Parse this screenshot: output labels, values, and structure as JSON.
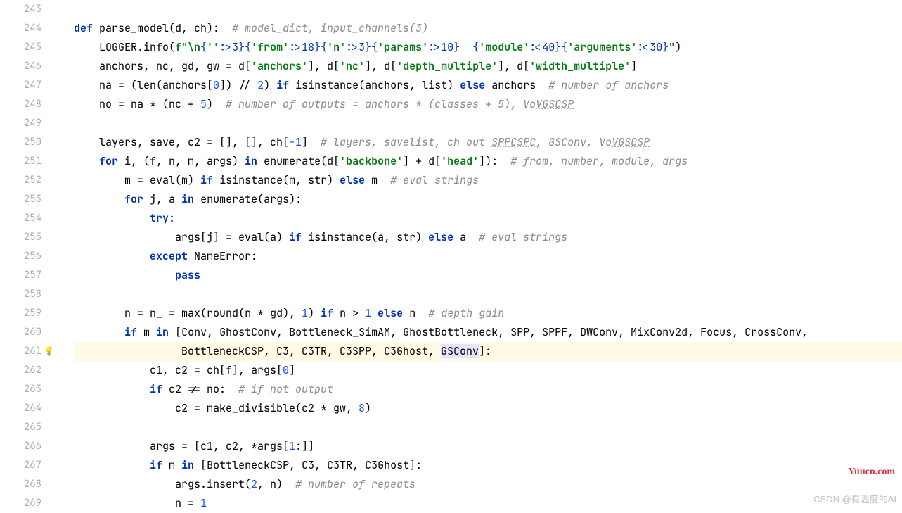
{
  "watermark_br": "CSDN @有温度的AI",
  "watermark_tr": "Yuucn.com",
  "lineStart": 243,
  "bulbLine": 261,
  "lines": [
    {
      "n": 243,
      "tokens": []
    },
    {
      "n": 244,
      "tokens": [
        {
          "t": "def ",
          "c": "kw"
        },
        {
          "t": "parse_model(d, ch):  ",
          "c": "fn"
        },
        {
          "t": "# model_dict, input_channels(3)",
          "c": "cmt"
        }
      ]
    },
    {
      "n": 245,
      "tokens": [
        {
          "t": "    LOGGER.info(",
          "c": "name"
        },
        {
          "t": "f\"\\n",
          "c": "str"
        },
        {
          "t": "{",
          "c": "fstr"
        },
        {
          "t": "''",
          "c": "str"
        },
        {
          "t": ":>3}{",
          "c": "fstr"
        },
        {
          "t": "'from'",
          "c": "str"
        },
        {
          "t": ":>18}{",
          "c": "fstr"
        },
        {
          "t": "'n'",
          "c": "str"
        },
        {
          "t": ":>3}{",
          "c": "fstr"
        },
        {
          "t": "'params'",
          "c": "str"
        },
        {
          "t": ":>10}",
          "c": "fstr"
        },
        {
          "t": "  ",
          "c": "str"
        },
        {
          "t": "{",
          "c": "fstr"
        },
        {
          "t": "'module'",
          "c": "str"
        },
        {
          "t": ":<40}{",
          "c": "fstr"
        },
        {
          "t": "'arguments'",
          "c": "str"
        },
        {
          "t": ":<30}",
          "c": "fstr"
        },
        {
          "t": "\"",
          "c": "str"
        },
        {
          "t": ")",
          "c": "name"
        }
      ]
    },
    {
      "n": 246,
      "tokens": [
        {
          "t": "    anchors, nc, gd, gw = d[",
          "c": "name"
        },
        {
          "t": "'anchors'",
          "c": "str"
        },
        {
          "t": "], d[",
          "c": "name"
        },
        {
          "t": "'nc'",
          "c": "str"
        },
        {
          "t": "], d[",
          "c": "name"
        },
        {
          "t": "'depth_multiple'",
          "c": "str"
        },
        {
          "t": "], d[",
          "c": "name"
        },
        {
          "t": "'width_multiple'",
          "c": "str"
        },
        {
          "t": "]",
          "c": "name"
        }
      ]
    },
    {
      "n": 247,
      "tokens": [
        {
          "t": "    na = (",
          "c": "name"
        },
        {
          "t": "len",
          "c": "builtin"
        },
        {
          "t": "(anchors[",
          "c": "name"
        },
        {
          "t": "0",
          "c": "num"
        },
        {
          "t": "]) // ",
          "c": "name"
        },
        {
          "t": "2",
          "c": "num"
        },
        {
          "t": ") ",
          "c": "name"
        },
        {
          "t": "if ",
          "c": "kw"
        },
        {
          "t": "isinstance",
          "c": "builtin"
        },
        {
          "t": "(anchors, ",
          "c": "name"
        },
        {
          "t": "list",
          "c": "builtin"
        },
        {
          "t": ") ",
          "c": "name"
        },
        {
          "t": "else ",
          "c": "kw"
        },
        {
          "t": "anchors  ",
          "c": "name"
        },
        {
          "t": "# number of anchors",
          "c": "cmt"
        }
      ]
    },
    {
      "n": 248,
      "tokens": [
        {
          "t": "    no = na * (nc + ",
          "c": "name"
        },
        {
          "t": "5",
          "c": "num"
        },
        {
          "t": ")  ",
          "c": "name"
        },
        {
          "t": "# number of outputs = anchors * (classes + 5), Vo",
          "c": "cmt"
        },
        {
          "t": "VGSCSP",
          "c": "cmt cmt-underline"
        }
      ]
    },
    {
      "n": 249,
      "tokens": []
    },
    {
      "n": 250,
      "tokens": [
        {
          "t": "    layers, save, c2 = [], [], ch[",
          "c": "name"
        },
        {
          "t": "-1",
          "c": "num"
        },
        {
          "t": "]  ",
          "c": "name"
        },
        {
          "t": "# layers, savelist, ch out ",
          "c": "cmt"
        },
        {
          "t": "SPPCSPC",
          "c": "cmt cmt-underline"
        },
        {
          "t": ", GSConv, Vo",
          "c": "cmt"
        },
        {
          "t": "VGSCSP",
          "c": "cmt cmt-underline"
        }
      ]
    },
    {
      "n": 251,
      "tokens": [
        {
          "t": "    ",
          "c": "name"
        },
        {
          "t": "for ",
          "c": "kw"
        },
        {
          "t": "i, (f, n, m, args) ",
          "c": "name"
        },
        {
          "t": "in ",
          "c": "kw"
        },
        {
          "t": "enumerate",
          "c": "builtin"
        },
        {
          "t": "(d[",
          "c": "name"
        },
        {
          "t": "'backbone'",
          "c": "str"
        },
        {
          "t": "] + d[",
          "c": "name"
        },
        {
          "t": "'head'",
          "c": "str"
        },
        {
          "t": "]):  ",
          "c": "name"
        },
        {
          "t": "# from, number, module, args",
          "c": "cmt"
        }
      ]
    },
    {
      "n": 252,
      "tokens": [
        {
          "t": "        m = ",
          "c": "name"
        },
        {
          "t": "eval",
          "c": "builtin"
        },
        {
          "t": "(m) ",
          "c": "name"
        },
        {
          "t": "if ",
          "c": "kw"
        },
        {
          "t": "isinstance",
          "c": "builtin"
        },
        {
          "t": "(m, ",
          "c": "name"
        },
        {
          "t": "str",
          "c": "builtin"
        },
        {
          "t": ") ",
          "c": "name"
        },
        {
          "t": "else ",
          "c": "kw"
        },
        {
          "t": "m  ",
          "c": "name"
        },
        {
          "t": "# eval strings",
          "c": "cmt"
        }
      ]
    },
    {
      "n": 253,
      "tokens": [
        {
          "t": "        ",
          "c": "name"
        },
        {
          "t": "for ",
          "c": "kw"
        },
        {
          "t": "j, a ",
          "c": "name"
        },
        {
          "t": "in ",
          "c": "kw"
        },
        {
          "t": "enumerate",
          "c": "builtin"
        },
        {
          "t": "(args):",
          "c": "name"
        }
      ]
    },
    {
      "n": 254,
      "tokens": [
        {
          "t": "            ",
          "c": "name"
        },
        {
          "t": "try",
          "c": "kw"
        },
        {
          "t": ":",
          "c": "name"
        }
      ]
    },
    {
      "n": 255,
      "tokens": [
        {
          "t": "                args[j] = ",
          "c": "name"
        },
        {
          "t": "eval",
          "c": "builtin"
        },
        {
          "t": "(a) ",
          "c": "name"
        },
        {
          "t": "if ",
          "c": "kw"
        },
        {
          "t": "isinstance",
          "c": "builtin"
        },
        {
          "t": "(a, ",
          "c": "name"
        },
        {
          "t": "str",
          "c": "builtin"
        },
        {
          "t": ") ",
          "c": "name"
        },
        {
          "t": "else ",
          "c": "kw"
        },
        {
          "t": "a  ",
          "c": "name"
        },
        {
          "t": "# eval strings",
          "c": "cmt"
        }
      ]
    },
    {
      "n": 256,
      "tokens": [
        {
          "t": "            ",
          "c": "name"
        },
        {
          "t": "except ",
          "c": "kw"
        },
        {
          "t": "NameError:",
          "c": "name"
        }
      ]
    },
    {
      "n": 257,
      "tokens": [
        {
          "t": "                ",
          "c": "name"
        },
        {
          "t": "pass",
          "c": "kw"
        }
      ]
    },
    {
      "n": 258,
      "tokens": []
    },
    {
      "n": 259,
      "tokens": [
        {
          "t": "        n = n_ = ",
          "c": "name"
        },
        {
          "t": "max",
          "c": "builtin"
        },
        {
          "t": "(",
          "c": "name"
        },
        {
          "t": "round",
          "c": "builtin"
        },
        {
          "t": "(n * gd), ",
          "c": "name"
        },
        {
          "t": "1",
          "c": "num"
        },
        {
          "t": ") ",
          "c": "name"
        },
        {
          "t": "if ",
          "c": "kw"
        },
        {
          "t": "n > ",
          "c": "name"
        },
        {
          "t": "1",
          "c": "num"
        },
        {
          "t": " ",
          "c": "name"
        },
        {
          "t": "else ",
          "c": "kw"
        },
        {
          "t": "n  ",
          "c": "name"
        },
        {
          "t": "# depth gain",
          "c": "cmt"
        }
      ]
    },
    {
      "n": 260,
      "tokens": [
        {
          "t": "        ",
          "c": "name"
        },
        {
          "t": "if ",
          "c": "kw"
        },
        {
          "t": "m ",
          "c": "name"
        },
        {
          "t": "in ",
          "c": "kw"
        },
        {
          "t": "[Conv, GhostConv, Bottleneck_SimAM, GhostBottleneck, SPP, SPPF, DWConv, MixConv2d, Focus, CrossConv,",
          "c": "name"
        }
      ]
    },
    {
      "n": 261,
      "hl": true,
      "tokens": [
        {
          "t": "                 BottleneckCSP, C3, C3TR, C3SPP, C3Ghost, ",
          "c": "name"
        },
        {
          "t": "GSConv",
          "c": "name self-hl"
        },
        {
          "t": "]:",
          "c": "name"
        }
      ]
    },
    {
      "n": 262,
      "tokens": [
        {
          "t": "            c1, c2 = ch[f], args[",
          "c": "name"
        },
        {
          "t": "0",
          "c": "num"
        },
        {
          "t": "]",
          "c": "name"
        }
      ]
    },
    {
      "n": 263,
      "tokens": [
        {
          "t": "            ",
          "c": "name"
        },
        {
          "t": "if ",
          "c": "kw"
        },
        {
          "t": "c2 != no:  ",
          "c": "name"
        },
        {
          "t": "# if not output",
          "c": "cmt"
        }
      ]
    },
    {
      "n": 264,
      "tokens": [
        {
          "t": "                c2 = make_divisible(c2 * gw, ",
          "c": "name"
        },
        {
          "t": "8",
          "c": "num"
        },
        {
          "t": ")",
          "c": "name"
        }
      ]
    },
    {
      "n": 265,
      "tokens": []
    },
    {
      "n": 266,
      "tokens": [
        {
          "t": "            args = [c1, c2, *args[",
          "c": "name"
        },
        {
          "t": "1",
          "c": "num"
        },
        {
          "t": ":]]",
          "c": "name"
        }
      ]
    },
    {
      "n": 267,
      "tokens": [
        {
          "t": "            ",
          "c": "name"
        },
        {
          "t": "if ",
          "c": "kw"
        },
        {
          "t": "m ",
          "c": "name"
        },
        {
          "t": "in ",
          "c": "kw"
        },
        {
          "t": "[BottleneckCSP, C3, C3TR, C3Ghost]:",
          "c": "name"
        }
      ]
    },
    {
      "n": 268,
      "tokens": [
        {
          "t": "                args.insert(",
          "c": "name"
        },
        {
          "t": "2",
          "c": "num"
        },
        {
          "t": ", n)  ",
          "c": "name"
        },
        {
          "t": "# number of repeats",
          "c": "cmt"
        }
      ]
    },
    {
      "n": 269,
      "tokens": [
        {
          "t": "                n = ",
          "c": "name"
        },
        {
          "t": "1",
          "c": "num"
        }
      ]
    }
  ]
}
